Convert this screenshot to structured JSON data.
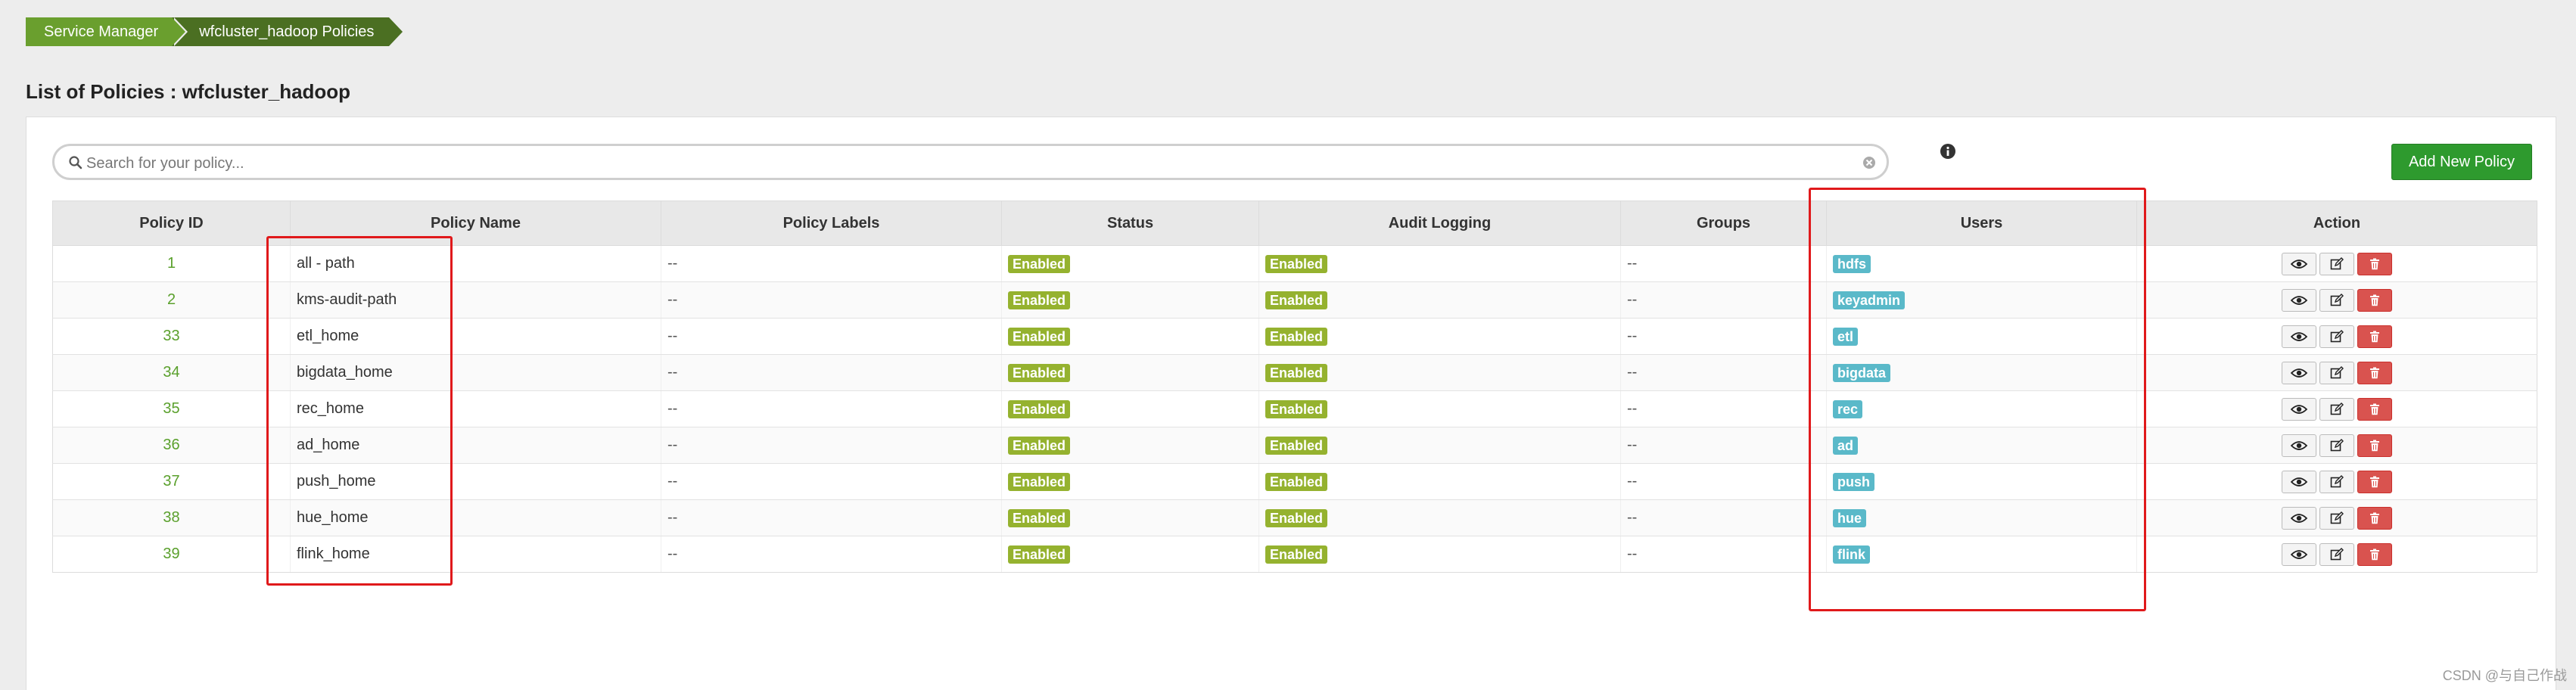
{
  "breadcrumb": {
    "items": [
      "Service Manager",
      "wfcluster_hadoop Policies"
    ]
  },
  "page": {
    "title": "List of Policies : wfcluster_hadoop"
  },
  "search": {
    "placeholder": "Search for your policy...",
    "value": ""
  },
  "actions": {
    "add_new_policy": "Add New Policy"
  },
  "table": {
    "columns": [
      "Policy ID",
      "Policy Name",
      "Policy Labels",
      "Status",
      "Audit Logging",
      "Groups",
      "Users",
      "Action"
    ],
    "rows": [
      {
        "id": "1",
        "name": "all - path",
        "labels": "--",
        "status": "Enabled",
        "audit": "Enabled",
        "groups": "--",
        "user": "hdfs"
      },
      {
        "id": "2",
        "name": "kms-audit-path",
        "labels": "--",
        "status": "Enabled",
        "audit": "Enabled",
        "groups": "--",
        "user": "keyadmin"
      },
      {
        "id": "33",
        "name": "etl_home",
        "labels": "--",
        "status": "Enabled",
        "audit": "Enabled",
        "groups": "--",
        "user": "etl"
      },
      {
        "id": "34",
        "name": "bigdata_home",
        "labels": "--",
        "status": "Enabled",
        "audit": "Enabled",
        "groups": "--",
        "user": "bigdata"
      },
      {
        "id": "35",
        "name": "rec_home",
        "labels": "--",
        "status": "Enabled",
        "audit": "Enabled",
        "groups": "--",
        "user": "rec"
      },
      {
        "id": "36",
        "name": "ad_home",
        "labels": "--",
        "status": "Enabled",
        "audit": "Enabled",
        "groups": "--",
        "user": "ad"
      },
      {
        "id": "37",
        "name": "push_home",
        "labels": "--",
        "status": "Enabled",
        "audit": "Enabled",
        "groups": "--",
        "user": "push"
      },
      {
        "id": "38",
        "name": "hue_home",
        "labels": "--",
        "status": "Enabled",
        "audit": "Enabled",
        "groups": "--",
        "user": "hue"
      },
      {
        "id": "39",
        "name": "flink_home",
        "labels": "--",
        "status": "Enabled",
        "audit": "Enabled",
        "groups": "--",
        "user": "flink"
      }
    ]
  },
  "icons": {
    "search": "search-icon",
    "clear": "clear-icon",
    "info": "info-icon",
    "view": "eye-icon",
    "edit": "edit-icon",
    "delete": "trash-icon"
  },
  "colors": {
    "breadcrumb_primary": "#6a9f2e",
    "breadcrumb_secondary": "#4b6f22",
    "add_button": "#2e9a2e",
    "status_badge": "#95b22f",
    "user_badge": "#5ab9c9",
    "delete_button": "#d9534f",
    "annotation_box": "#e0191b",
    "policy_id_link": "#5aa02c"
  },
  "watermark": "CSDN @与自己作战"
}
